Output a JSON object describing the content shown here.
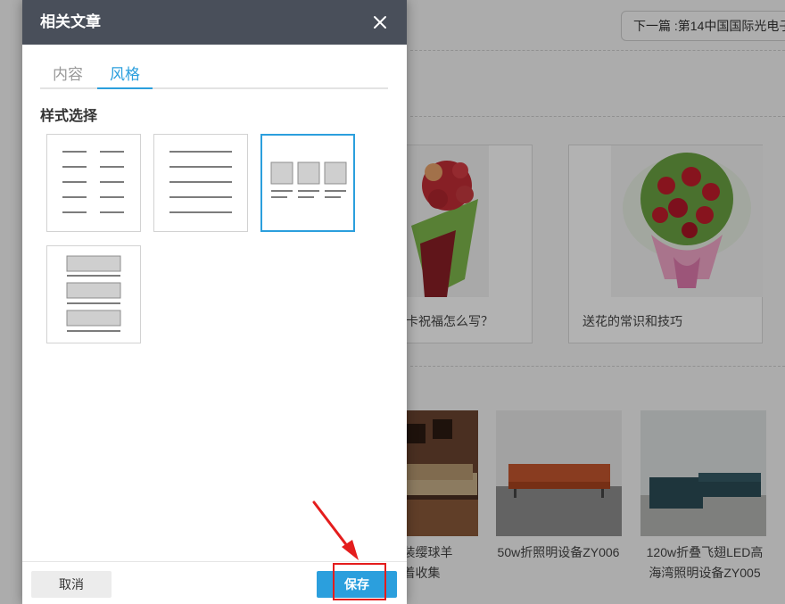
{
  "background": {
    "next_article": "下一篇 :第14中国国际光电子",
    "cards": [
      {
        "caption": "贺卡祝福怎么写？"
      },
      {
        "caption": "送花的常识和技巧"
      }
    ],
    "products": [
      {
        "caption": "式从装缨球羊\n毛着收集"
      },
      {
        "caption": "50w折照明设备ZY006"
      },
      {
        "caption": "120w折叠飞翅LED高\n海湾照明设备ZY005"
      }
    ]
  },
  "dialog": {
    "title": "相关文章",
    "close_icon": "close-icon",
    "tabs": [
      {
        "label": "内容",
        "active": false
      },
      {
        "label": "风格",
        "active": true
      }
    ],
    "section_label": "样式选择",
    "style_options": [
      {
        "name": "two-column-list",
        "selected": false
      },
      {
        "name": "single-column-list",
        "selected": false
      },
      {
        "name": "three-column-image-grid",
        "selected": true
      },
      {
        "name": "stacked-image-list",
        "selected": false
      }
    ],
    "cancel_label": "取消",
    "save_label": "保存"
  },
  "colors": {
    "accent": "#2b9fdd",
    "header": "#494f5a",
    "annotation": "#e41d1d"
  }
}
